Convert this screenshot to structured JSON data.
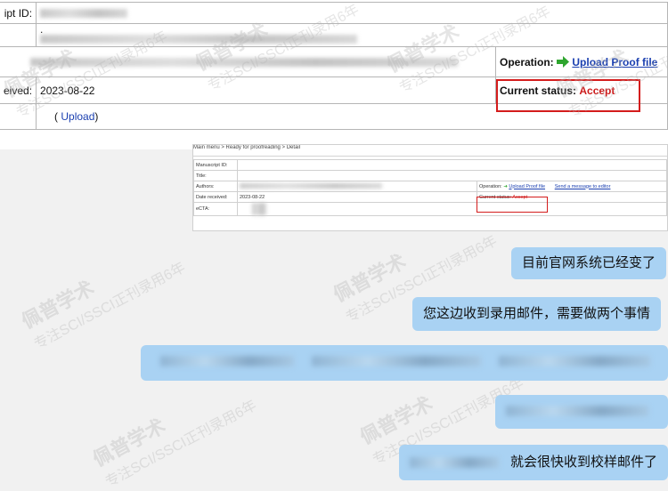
{
  "manuscript": {
    "id_label": "ipt ID:",
    "title_dot": ".",
    "operation_label": "Operation:",
    "upload_proof": "Upload Proof file",
    "date_label": "eived:",
    "date_value": "2023-08-22",
    "status_label": "Current status:",
    "status_value": "Accept",
    "upload_open": "(",
    "upload_link": "Upload",
    "upload_close": ")",
    "arrow_color": "#2ea52e",
    "status_color": "#cc1b1b"
  },
  "mini": {
    "breadcrumb": "Main menu  >  Ready for proofreading  >  Detail",
    "rows": {
      "manuscript_id": "Manuscript ID:",
      "title": "Title:",
      "authors": "Authors:",
      "date_received": "Date received:",
      "date_value": "2023-08-22",
      "ecta": "eCTA:"
    },
    "operation_label": "Operation:",
    "upload_proof": "Upload Proof file",
    "send_message": "Send a message to editor",
    "status_label": "Current status:",
    "status_value": "Accept"
  },
  "chat": {
    "msg1": "目前官网系统已经变了",
    "msg2": "您这边收到录用邮件，需要做两个事情",
    "msg5_visible": "就会很快收到校样邮件了"
  },
  "watermark": {
    "brand": "佩普学术",
    "slogan": "专注SCI/SSCI正刊录用6年"
  }
}
